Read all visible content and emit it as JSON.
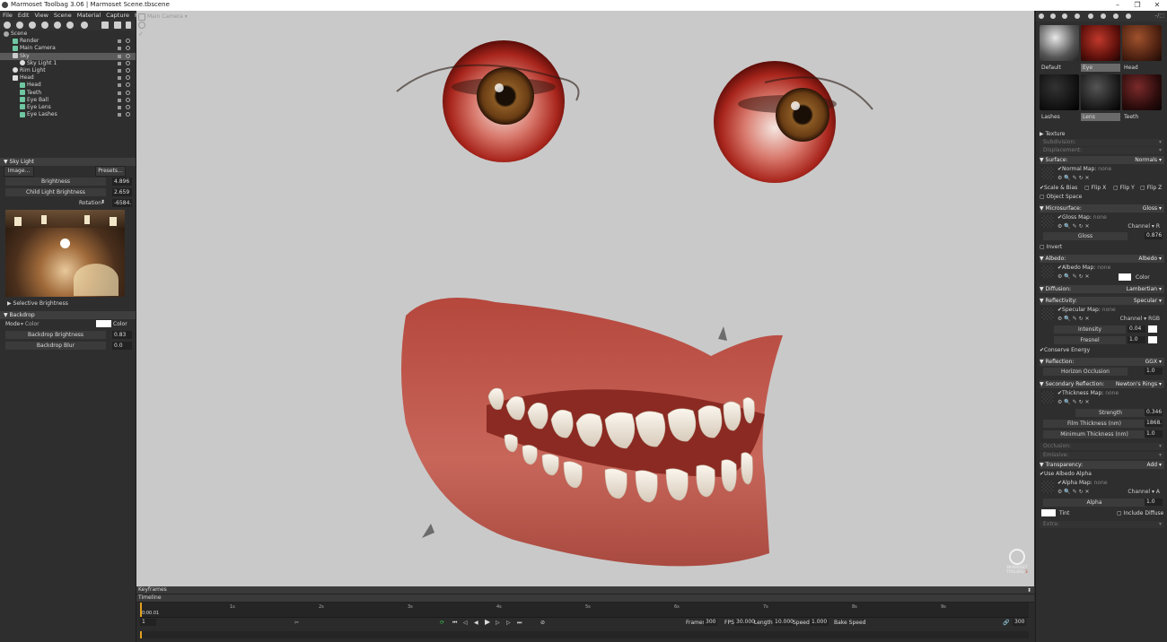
{
  "window": {
    "title": "Marmoset Toolbag 3.06  |  Marmoset Scene.tbscene"
  },
  "menu": [
    "File",
    "Edit",
    "View",
    "Scene",
    "Material",
    "Capture",
    "Help"
  ],
  "scene_tree": [
    {
      "label": "Scene",
      "indent": 0,
      "sel": false
    },
    {
      "label": "Render",
      "indent": 1,
      "sel": false
    },
    {
      "label": "Main Camera",
      "indent": 1,
      "sel": false
    },
    {
      "label": "Sky",
      "indent": 1,
      "sel": true
    },
    {
      "label": "Sky Light 1",
      "indent": 2,
      "sel": false
    },
    {
      "label": "Rim Light",
      "indent": 1,
      "sel": false
    },
    {
      "label": "Head",
      "indent": 1,
      "sel": false
    },
    {
      "label": "Head",
      "indent": 2,
      "sel": false
    },
    {
      "label": "Teeth",
      "indent": 2,
      "sel": false
    },
    {
      "label": "Eye Ball",
      "indent": 2,
      "sel": false
    },
    {
      "label": "Eye Lens",
      "indent": 2,
      "sel": false
    },
    {
      "label": "Eye Lashes",
      "indent": 2,
      "sel": false
    }
  ],
  "sky": {
    "header": "Sky Light",
    "image_btn": "Image...",
    "presets_btn": "Presets...",
    "brightness_label": "Brightness",
    "brightness": "4.896",
    "child_label": "Child Light Brightness",
    "child": "2.659",
    "rotation_label": "Rotation",
    "rotation": "-6584.",
    "selective": "Selective Brightness"
  },
  "backdrop": {
    "header": "Backdrop",
    "mode_label": "Mode",
    "mode_value": "Color",
    "color_label": "Color",
    "brightness_label": "Backdrop Brightness",
    "brightness": "0.83",
    "blur_label": "Backdrop Blur",
    "blur": "0.0"
  },
  "viewport": {
    "camera": "Main Camera"
  },
  "materials": [
    {
      "label": "Default",
      "bg": "radial-gradient(circle at 40% 35%, #e8e8e8, #555 60%, #222)"
    },
    {
      "label": "Eye",
      "bg": "radial-gradient(circle at 45% 40%, #c0392b, #5a0f0a 65%, #1a0605)"
    },
    {
      "label": "Head",
      "bg": "radial-gradient(circle at 40% 35%, #a0522d, #4a1f10 65%, #1a0a05)"
    },
    {
      "label": "Lashes",
      "bg": "radial-gradient(circle at 40% 35%, #333, #111 65%, #000)"
    },
    {
      "label": "Lens",
      "bg": "radial-gradient(circle at 40% 35%, #555, #1a1a1a 65%, #000)"
    },
    {
      "label": "Teeth",
      "bg": "radial-gradient(circle at 40% 35%, #7a2a2a, #2a0b0b 65%, #0a0303)"
    }
  ],
  "material_props": {
    "texture": "Texture",
    "subdivision": "Subdivision:",
    "displacement": "Displacement:",
    "surface": "Surface:",
    "surface_val": "Normals",
    "normal_map": "Normal Map:",
    "none": "none",
    "scale_bias": "Scale & Bias",
    "flip_x": "Flip X",
    "flip_y": "Flip Y",
    "flip_z": "Flip Z",
    "object_space": "Object Space",
    "microsurface": "Microsurface:",
    "micro_val": "Gloss",
    "gloss_map": "Gloss Map:",
    "channel": "Channel",
    "channel_r": "R",
    "gloss": "Gloss",
    "gloss_val": "0.876",
    "invert": "Invert",
    "albedo": "Albedo:",
    "albedo_val": "Albedo",
    "albedo_map": "Albedo Map:",
    "color": "Color",
    "diffusion": "Diffusion:",
    "diffusion_val": "Lambertian",
    "reflectivity": "Reflectivity:",
    "reflectivity_val": "Specular",
    "specular_map": "Specular Map:",
    "channel_rgb": "RGB",
    "intensity": "Intensity",
    "intensity_val": "0.04",
    "fresnel": "Fresnel",
    "fresnel_val": "1.0",
    "conserve": "Conserve Energy",
    "reflection": "Reflection:",
    "reflection_val": "GGX",
    "horizon": "Horizon Occlusion",
    "horizon_val": "1.0",
    "secondary": "Secondary Reflection:",
    "secondary_val": "Newton's Rings",
    "thickness_map": "Thickness Map:",
    "strength": "Strength",
    "strength_val": "0.346",
    "film": "Film Thickness (nm)",
    "film_val": "1868.",
    "min_thick": "Minimum Thickness (nm)",
    "min_thick_val": "1.0",
    "occlusion": "Occlusion:",
    "emissive": "Emissive:",
    "transparency": "Transparency:",
    "transparency_val": "Add",
    "use_albedo_alpha": "Use Albedo Alpha",
    "alpha_map": "Alpha Map:",
    "channel_a": "A",
    "alpha": "Alpha",
    "alpha_val": "1.0",
    "tint": "Tint",
    "include_diffuse": "Include Diffuse",
    "extra": "Extra:"
  },
  "timeline": {
    "keyframes": "Keyframes",
    "timeline": "Timeline",
    "time": "0:00.01",
    "frame": "1",
    "ticks": [
      "1s",
      "2s",
      "3s",
      "4s",
      "5s",
      "6s",
      "7s",
      "8s",
      "9s"
    ],
    "frames_label": "Frames",
    "frames": "300",
    "fps_label": "FPS",
    "fps": "30.000",
    "length_label": "Length",
    "length": "10.000",
    "speed_label": "Speed",
    "speed": "1.000",
    "bake_speed": "Bake Speed",
    "end_frame": "300"
  },
  "logo": {
    "line1": "MARMOSET",
    "line2": "TOOLBAG",
    "version": "3"
  }
}
